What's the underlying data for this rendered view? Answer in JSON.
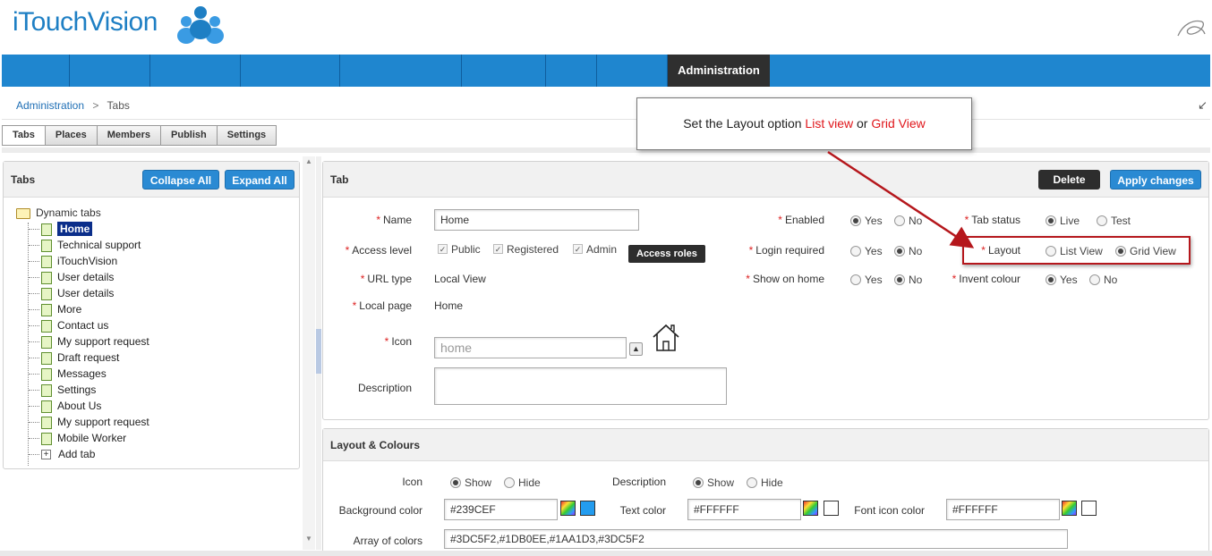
{
  "header": {
    "logo_text": "iTouchVision"
  },
  "nav": {
    "active_label": "Administration"
  },
  "breadcrumb": {
    "root": "Administration",
    "separator": ">",
    "current": "Tabs"
  },
  "tabs": [
    "Tabs",
    "Places",
    "Members",
    "Publish",
    "Settings"
  ],
  "left_panel": {
    "title": "Tabs",
    "collapse_label": "Collapse All",
    "expand_label": "Expand All",
    "root": "Dynamic tabs",
    "items": [
      "Home",
      "Technical support",
      "iTouchVision",
      "User details",
      "User details",
      "More",
      "Contact us",
      "My support request",
      "Draft request",
      "Messages",
      "Settings",
      "About Us",
      "My support request",
      "Mobile Worker"
    ],
    "add_label": "Add tab"
  },
  "tab_form": {
    "title": "Tab",
    "delete_label": "Delete",
    "apply_label": "Apply changes",
    "name_label": "Name",
    "name_value": "Home",
    "access_label": "Access level",
    "access_opts": [
      "Public",
      "Registered",
      "Admin"
    ],
    "access_roles_label": "Access roles",
    "url_type_label": "URL type",
    "url_type_value": "Local View",
    "local_page_label": "Local page",
    "local_page_value": "Home",
    "icon_label": "Icon",
    "icon_placeholder": "home",
    "description_label": "Description",
    "enabled_label": "Enabled",
    "login_label": "Login required",
    "show_home_label": "Show on home",
    "yes": "Yes",
    "no": "No",
    "status_label": "Tab status",
    "status_live": "Live",
    "status_test": "Test",
    "layout_label": "Layout",
    "layout_list": "List View",
    "layout_grid": "Grid View",
    "invent_label": "Invent colour"
  },
  "layout_colours": {
    "title": "Layout & Colours",
    "icon_label": "Icon",
    "show": "Show",
    "hide": "Hide",
    "description_label": "Description",
    "bg_label": "Background color",
    "bg_value": "#239CEF",
    "text_label": "Text color",
    "text_value": "#FFFFFF",
    "font_icon_label": "Font icon color",
    "font_icon_value": "#FFFFFF",
    "array_label": "Array of colors",
    "array_value": "#3DC5F2,#1DB0EE,#1AA1D3,#3DC5F2"
  },
  "annotation": {
    "text_pre": "Set the Layout option",
    "list": "List view",
    "or": "or",
    "grid": "Grid View"
  },
  "colors": {
    "nav_blue": "#1F86CF",
    "accent_red": "#E0161B",
    "swatch_bg": "#239CEF",
    "swatch_text": "#FFFFFF",
    "swatch_font_icon": "#FFFFFF"
  }
}
